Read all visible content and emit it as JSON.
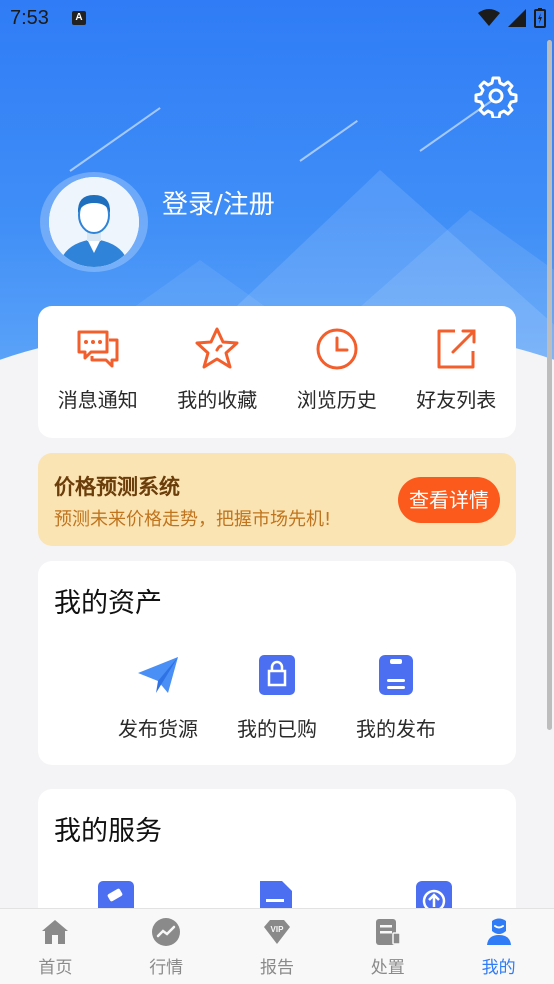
{
  "status_bar": {
    "time": "7:53"
  },
  "header": {
    "login_text": "登录/注册"
  },
  "quick_menu": [
    {
      "label": "消息通知",
      "icon": "message-icon"
    },
    {
      "label": "我的收藏",
      "icon": "star-icon"
    },
    {
      "label": "浏览历史",
      "icon": "clock-icon"
    },
    {
      "label": "好友列表",
      "icon": "share-icon"
    }
  ],
  "banner": {
    "title": "价格预测系统",
    "subtitle": "预测未来价格走势，把握市场先机!",
    "button": "查看详情"
  },
  "assets": {
    "title": "我的资产",
    "items": [
      {
        "label": "发布货源",
        "icon": "paper-plane-icon"
      },
      {
        "label": "我的已购",
        "icon": "shopping-bag-icon"
      },
      {
        "label": "我的发布",
        "icon": "document-icon"
      }
    ]
  },
  "services": {
    "title": "我的服务",
    "items": [
      {
        "icon": "gavel-icon"
      },
      {
        "icon": "file-icon"
      },
      {
        "icon": "cloud-upload-icon"
      }
    ]
  },
  "bottom_nav": [
    {
      "label": "首页",
      "icon": "home-icon",
      "active": false
    },
    {
      "label": "行情",
      "icon": "trend-icon",
      "active": false
    },
    {
      "label": "报告",
      "icon": "vip-diamond-icon",
      "active": false
    },
    {
      "label": "处置",
      "icon": "clipboard-icon",
      "active": false
    },
    {
      "label": "我的",
      "icon": "user-icon",
      "active": true
    }
  ],
  "colors": {
    "primary": "#2f7cf6",
    "accent": "#f25f2c",
    "banner_bg": "#fbe4b4",
    "banner_button": "#fb5a1c"
  }
}
